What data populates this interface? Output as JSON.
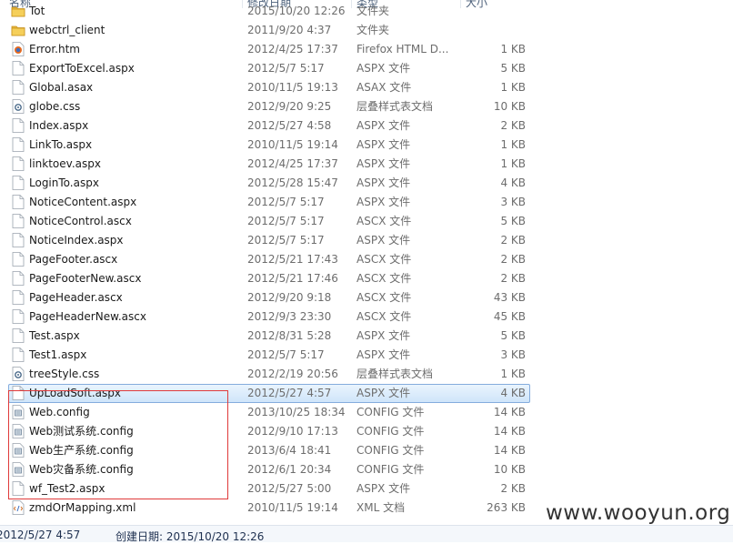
{
  "header": {
    "col_name": "名称",
    "col_date": "修改日期",
    "col_type": "类型",
    "col_size": "大小"
  },
  "files": [
    {
      "name": "Tot",
      "date": "2015/10/20 12:26",
      "type": "文件夹",
      "size": "",
      "icon": "folder-icon"
    },
    {
      "name": "webctrl_client",
      "date": "2011/9/20 4:37",
      "type": "文件夹",
      "size": "",
      "icon": "folder-icon"
    },
    {
      "name": "Error.htm",
      "date": "2012/4/25 17:37",
      "type": "Firefox HTML D...",
      "size": "1 KB",
      "icon": "firefox-html-icon"
    },
    {
      "name": "ExportToExcel.aspx",
      "date": "2012/5/7 5:17",
      "type": "ASPX 文件",
      "size": "5 KB",
      "icon": "file-icon"
    },
    {
      "name": "Global.asax",
      "date": "2010/11/5 19:13",
      "type": "ASAX 文件",
      "size": "1 KB",
      "icon": "file-icon"
    },
    {
      "name": "globe.css",
      "date": "2012/9/20 9:25",
      "type": "层叠样式表文档",
      "size": "10 KB",
      "icon": "css-icon"
    },
    {
      "name": "Index.aspx",
      "date": "2012/5/27 4:58",
      "type": "ASPX 文件",
      "size": "2 KB",
      "icon": "file-icon"
    },
    {
      "name": "LinkTo.aspx",
      "date": "2010/11/5 19:14",
      "type": "ASPX 文件",
      "size": "1 KB",
      "icon": "file-icon"
    },
    {
      "name": "linktoev.aspx",
      "date": "2012/4/25 17:37",
      "type": "ASPX 文件",
      "size": "1 KB",
      "icon": "file-icon"
    },
    {
      "name": "LoginTo.aspx",
      "date": "2012/5/28 15:47",
      "type": "ASPX 文件",
      "size": "4 KB",
      "icon": "file-icon"
    },
    {
      "name": "NoticeContent.aspx",
      "date": "2012/5/7 5:17",
      "type": "ASPX 文件",
      "size": "3 KB",
      "icon": "file-icon"
    },
    {
      "name": "NoticeControl.ascx",
      "date": "2012/5/7 5:17",
      "type": "ASCX 文件",
      "size": "5 KB",
      "icon": "file-icon"
    },
    {
      "name": "NoticeIndex.aspx",
      "date": "2012/5/7 5:17",
      "type": "ASPX 文件",
      "size": "2 KB",
      "icon": "file-icon"
    },
    {
      "name": "PageFooter.ascx",
      "date": "2012/5/21 17:43",
      "type": "ASCX 文件",
      "size": "2 KB",
      "icon": "file-icon"
    },
    {
      "name": "PageFooterNew.ascx",
      "date": "2012/5/21 17:46",
      "type": "ASCX 文件",
      "size": "2 KB",
      "icon": "file-icon"
    },
    {
      "name": "PageHeader.ascx",
      "date": "2012/9/20 9:18",
      "type": "ASCX 文件",
      "size": "43 KB",
      "icon": "file-icon"
    },
    {
      "name": "PageHeaderNew.ascx",
      "date": "2012/9/3 23:30",
      "type": "ASCX 文件",
      "size": "45 KB",
      "icon": "file-icon"
    },
    {
      "name": "Test.aspx",
      "date": "2012/8/31 5:28",
      "type": "ASPX 文件",
      "size": "5 KB",
      "icon": "file-icon"
    },
    {
      "name": "Test1.aspx",
      "date": "2012/5/7 5:17",
      "type": "ASPX 文件",
      "size": "3 KB",
      "icon": "file-icon"
    },
    {
      "name": "treeStyle.css",
      "date": "2012/2/19 20:56",
      "type": "层叠样式表文档",
      "size": "1 KB",
      "icon": "css-icon"
    },
    {
      "name": "UpLoadSoft.aspx",
      "date": "2012/5/27 4:57",
      "type": "ASPX 文件",
      "size": "4 KB",
      "icon": "file-icon",
      "selected": true
    },
    {
      "name": "Web.config",
      "date": "2013/10/25 18:34",
      "type": "CONFIG 文件",
      "size": "14 KB",
      "icon": "config-icon"
    },
    {
      "name": "Web测试系统.config",
      "date": "2012/9/10 17:13",
      "type": "CONFIG 文件",
      "size": "14 KB",
      "icon": "config-icon"
    },
    {
      "name": "Web生产系统.config",
      "date": "2013/6/4 18:41",
      "type": "CONFIG 文件",
      "size": "14 KB",
      "icon": "config-icon"
    },
    {
      "name": "Web灾备系统.config",
      "date": "2012/6/1 20:34",
      "type": "CONFIG 文件",
      "size": "10 KB",
      "icon": "config-icon"
    },
    {
      "name": "wf_Test2.aspx",
      "date": "2012/5/27 5:00",
      "type": "ASPX 文件",
      "size": "2 KB",
      "icon": "file-icon"
    },
    {
      "name": "zmdOrMapping.xml",
      "date": "2010/11/5 19:14",
      "type": "XML 文档",
      "size": "263 KB",
      "icon": "xml-icon"
    }
  ],
  "status": {
    "modified": "2012/5/27 4:57",
    "created": "创建日期: 2015/10/20 12:26"
  },
  "watermark": "www.wooyun.org",
  "colors": {
    "selection": "#cfe5fa",
    "selection_border": "#84acdd",
    "highlight_box": "#e03a3a",
    "folder": "#e8b93c"
  }
}
